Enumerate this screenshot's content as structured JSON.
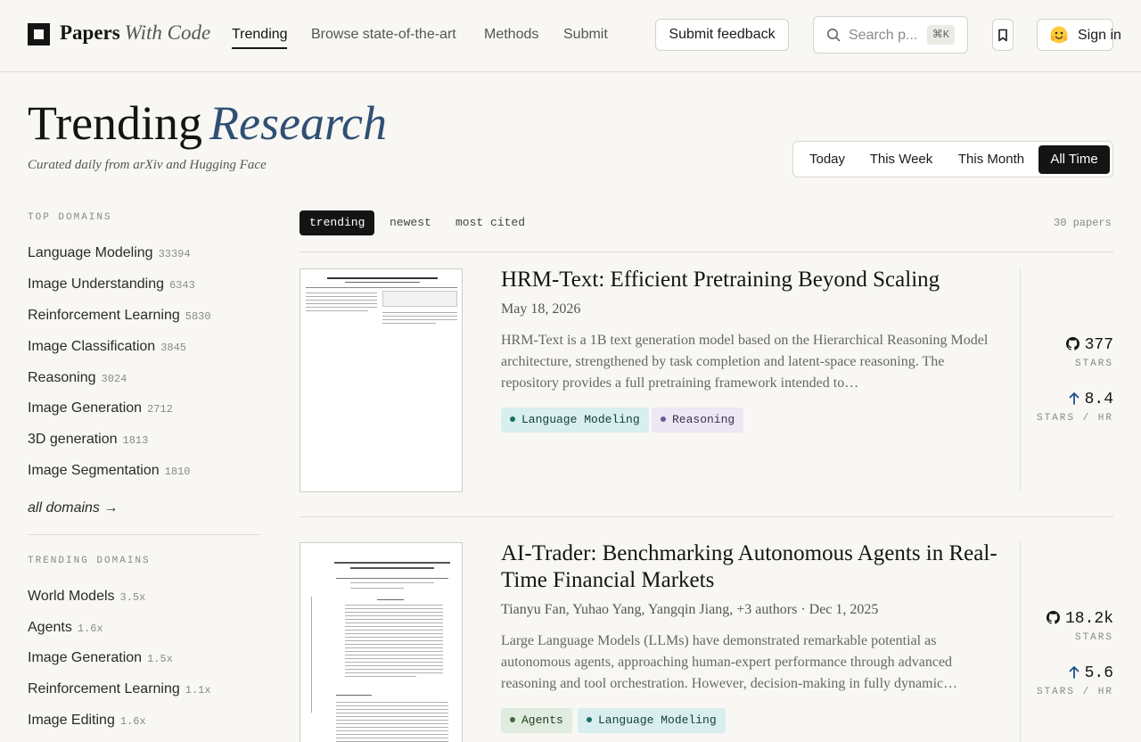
{
  "header": {
    "logo_bold": "Papers",
    "logo_italic": "With Code",
    "nav": [
      {
        "label": "Trending",
        "active": true
      },
      {
        "label": "Browse state-of-the-art",
        "active": false
      },
      {
        "label": "Methods",
        "active": false
      },
      {
        "label": "Submit",
        "active": false
      }
    ],
    "feedback_label": "Submit feedback",
    "search_placeholder": "Search p...",
    "search_shortcut": "⌘K",
    "signin_label": "Sign in"
  },
  "hero": {
    "title_main": "Trending",
    "title_accent": "Research",
    "subtitle": "Curated daily from arXiv and Hugging Face",
    "ranges": [
      "Today",
      "This Week",
      "This Month",
      "All Time"
    ],
    "active_range": "All Time"
  },
  "sidebar": {
    "top_heading": "TOP DOMAINS",
    "top_domains": [
      {
        "name": "Language Modeling",
        "count": "33394"
      },
      {
        "name": "Image Understanding",
        "count": "6343"
      },
      {
        "name": "Reinforcement Learning",
        "count": "5830"
      },
      {
        "name": "Image Classification",
        "count": "3845"
      },
      {
        "name": "Reasoning",
        "count": "3024"
      },
      {
        "name": "Image Generation",
        "count": "2712"
      },
      {
        "name": "3D generation",
        "count": "1813"
      },
      {
        "name": "Image Segmentation",
        "count": "1810"
      }
    ],
    "all_domains": "all domains →",
    "trending_heading": "TRENDING DOMAINS",
    "trending_domains": [
      {
        "name": "World Models",
        "count": "3.5x"
      },
      {
        "name": "Agents",
        "count": "1.6x"
      },
      {
        "name": "Image Generation",
        "count": "1.5x"
      },
      {
        "name": "Reinforcement Learning",
        "count": "1.1x"
      },
      {
        "name": "Image Editing",
        "count": "1.6x"
      }
    ]
  },
  "feed": {
    "tabs": [
      "trending",
      "newest",
      "most cited"
    ],
    "active_tab": "trending",
    "paper_count": "30 papers",
    "papers": [
      {
        "title": "HRM-Text: Efficient Pretraining Beyond Scaling",
        "meta": "May 18, 2026",
        "abstract": "HRM-Text is a 1B text generation model based on the Hierarchical Reasoning Model architecture, strengthened by task completion and latent-space reasoning. The repository provides a full pretraining framework intended to…",
        "tags": [
          {
            "label": "Language Modeling",
            "color": "teal"
          },
          {
            "label": "Reasoning",
            "color": "purple"
          }
        ],
        "stars": "377",
        "stars_label": "STARS",
        "stars_per_hr": "8.4",
        "stars_per_hr_label": "STARS / HR"
      },
      {
        "title": "AI-Trader: Benchmarking Autonomous Agents in Real-Time Financial Markets",
        "meta": "Tianyu Fan, Yuhao Yang, Yangqin Jiang, +3 authors · Dec 1, 2025",
        "abstract": "Large Language Models (LLMs) have demonstrated remarkable potential as autonomous agents, approaching human-expert performance through advanced reasoning and tool orchestration. However, decision-making in fully dynamic…",
        "tags": [
          {
            "label": "Agents",
            "color": "green"
          },
          {
            "label": "Language Modeling",
            "color": "teal"
          }
        ],
        "stars": "18.2k",
        "stars_label": "STARS",
        "stars_per_hr": "5.6",
        "stars_per_hr_label": "STARS / HR"
      }
    ]
  }
}
